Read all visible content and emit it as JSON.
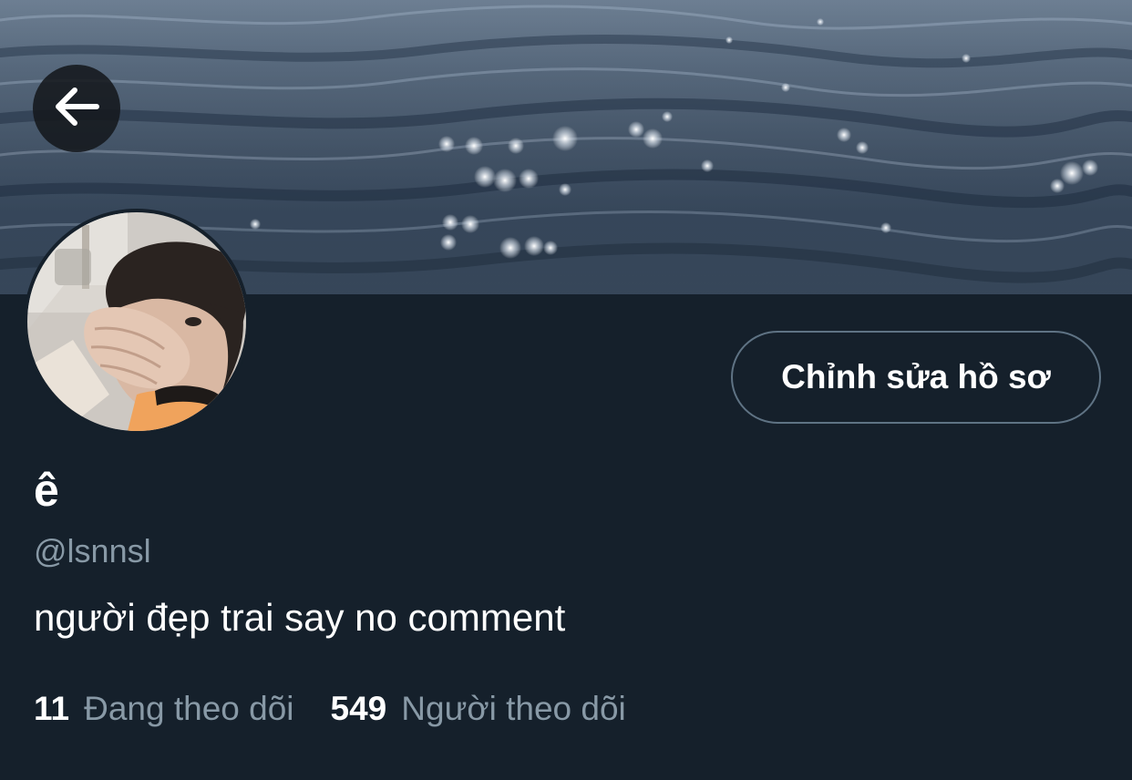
{
  "header": {
    "back_icon": "arrow-left-icon",
    "banner_image": "sea-water-sparkle-banner"
  },
  "profile": {
    "avatar_image": "person-covering-face-avatar",
    "edit_button_label": "Chỉnh sửa hồ sơ",
    "display_name": "ê",
    "handle": "@lsnnsl",
    "bio": "người đẹp trai say no comment"
  },
  "stats": {
    "following": {
      "count": "11",
      "label": "Đang theo dõi"
    },
    "followers": {
      "count": "549",
      "label": "Người theo dõi"
    }
  },
  "colors": {
    "background": "#15202b",
    "primary_text": "#ffffff",
    "secondary_text": "#8899a6",
    "button_border": "#5f7384"
  }
}
